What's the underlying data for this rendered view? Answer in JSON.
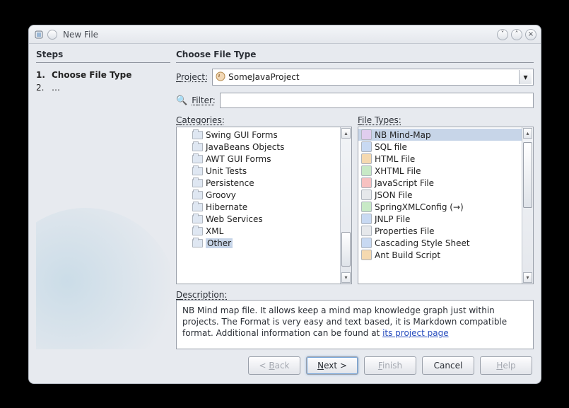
{
  "window": {
    "title": "New File"
  },
  "steps": {
    "heading": "Steps",
    "items": [
      {
        "num": "1.",
        "label": "Choose File Type",
        "current": true
      },
      {
        "num": "2.",
        "label": "…",
        "current": false
      }
    ]
  },
  "main": {
    "heading": "Choose File Type",
    "project_label": "Project:",
    "project_value": "SomeJavaProject",
    "filter_label": "Filter:",
    "filter_value": "",
    "categories_label": "Categories:",
    "filetypes_label": "File Types:",
    "description_label": "Description:",
    "description_text": "NB Mind map file. It allows keep a mind map knowledge graph just within projects. The Format is very easy and text based, it is Markdown compatible format. Additional information can be found at ",
    "description_link": "its project page"
  },
  "categories": [
    {
      "name": "Swing GUI Forms",
      "selected": false
    },
    {
      "name": "JavaBeans Objects",
      "selected": false
    },
    {
      "name": "AWT GUI Forms",
      "selected": false
    },
    {
      "name": "Unit Tests",
      "selected": false
    },
    {
      "name": "Persistence",
      "selected": false
    },
    {
      "name": "Groovy",
      "selected": false
    },
    {
      "name": "Hibernate",
      "selected": false
    },
    {
      "name": "Web Services",
      "selected": false
    },
    {
      "name": "XML",
      "selected": false
    },
    {
      "name": "Other",
      "selected": true
    }
  ],
  "filetypes": [
    {
      "name": "NB Mind-Map",
      "icon": "purple",
      "selected": true
    },
    {
      "name": "SQL file",
      "icon": "blue",
      "selected": false
    },
    {
      "name": "HTML File",
      "icon": "orange",
      "selected": false
    },
    {
      "name": "XHTML File",
      "icon": "green",
      "selected": false
    },
    {
      "name": "JavaScript File",
      "icon": "red",
      "selected": false
    },
    {
      "name": "JSON File",
      "icon": "gray",
      "selected": false
    },
    {
      "name": "SpringXMLConfig (→)",
      "icon": "green",
      "selected": false
    },
    {
      "name": "JNLP File",
      "icon": "blue",
      "selected": false
    },
    {
      "name": "Properties File",
      "icon": "gray",
      "selected": false
    },
    {
      "name": "Cascading Style Sheet",
      "icon": "blue",
      "selected": false
    },
    {
      "name": "Ant Build Script",
      "icon": "orange",
      "selected": false
    }
  ],
  "buttons": {
    "back": "< Back",
    "next": "Next >",
    "finish": "Finish",
    "cancel": "Cancel",
    "help": "Help"
  }
}
